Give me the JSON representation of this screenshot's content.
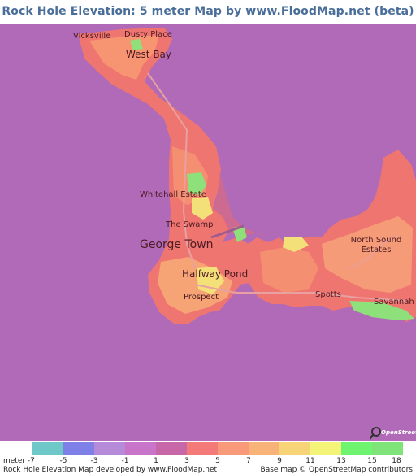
{
  "title": "Rock Hole Elevation: 5 meter Map by www.FloodMap.net (beta)",
  "places": [
    {
      "name": "Vicksville",
      "id": "place-vicksville"
    },
    {
      "name": "Dusty Place",
      "id": "place-dusty-place"
    },
    {
      "name": "West Bay",
      "id": "place-west-bay"
    },
    {
      "name": "Whitehall Estate",
      "id": "place-whitehall-estate"
    },
    {
      "name": "The Swamp",
      "id": "place-the-swamp"
    },
    {
      "name": "George Town",
      "id": "place-george-town"
    },
    {
      "name": "Halfway Pond",
      "id": "place-halfway-pond"
    },
    {
      "name": "Prospect",
      "id": "place-prospect"
    },
    {
      "name": "North Sound Estates",
      "id": "place-north-sound-estates"
    },
    {
      "name": "Spotts",
      "id": "place-spotts"
    },
    {
      "name": "Savannah",
      "id": "place-savannah"
    }
  ],
  "osm_logo_text": "OpenStreetMap",
  "legend": {
    "unit_label": "meter -7",
    "colors": [
      "#6fc8c8",
      "#7f7fe8",
      "#b58ad8",
      "#c874c8",
      "#c867a8",
      "#f47a7a",
      "#f89a7a",
      "#f8b478",
      "#f8d478",
      "#f4f478",
      "#6ef46e",
      "#7ee47a"
    ],
    "ticks": [
      "-5",
      "-3",
      "-1",
      "1",
      "3",
      "5",
      "7",
      "9",
      "11",
      "13",
      "15",
      "18"
    ]
  },
  "credits": {
    "left": "Rock Hole Elevation Map developed by www.FloodMap.net",
    "right": "Base map © OpenStreetMap contributors"
  },
  "colors": {
    "sea": "#b06ab8",
    "land_low": "#f47a7a",
    "land_mid": "#f8a87a",
    "land_high": "#7ee47a",
    "title": "#4a6e9a"
  }
}
